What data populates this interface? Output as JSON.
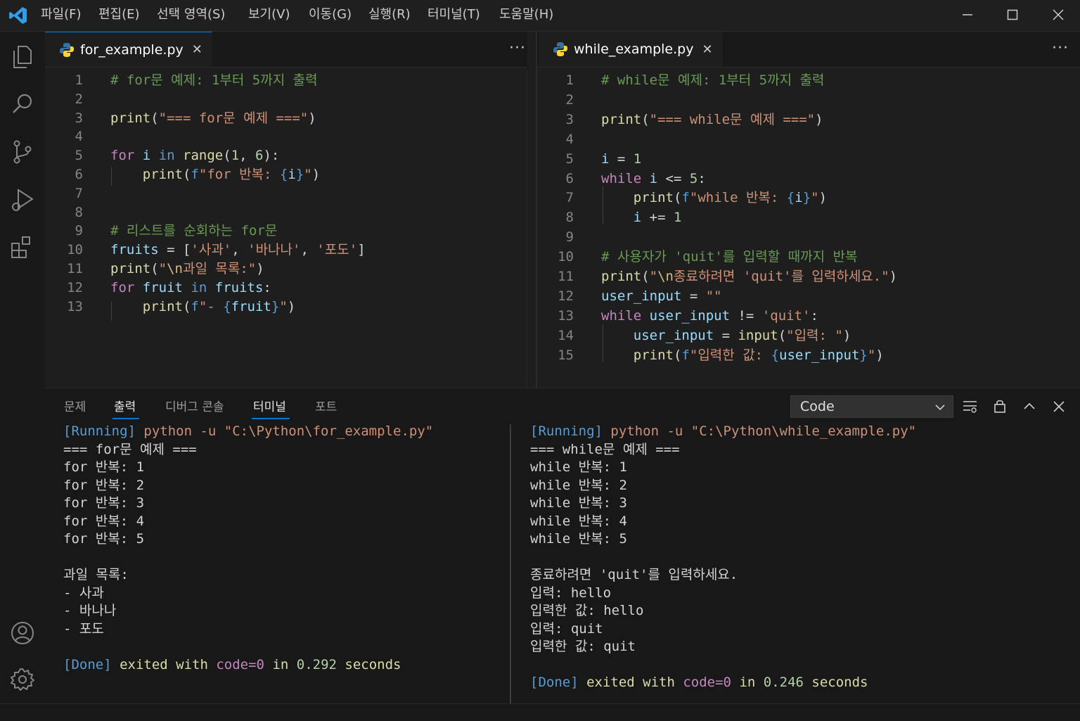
{
  "menu": [
    "파일(F)",
    "편집(E)",
    "선택 영역(S)",
    "보기(V)",
    "이동(G)",
    "실행(R)",
    "터미널(T)",
    "도움말(H)"
  ],
  "activity_icons": [
    "explorer-icon",
    "search-icon",
    "source-control-icon",
    "run-debug-icon",
    "extensions-icon",
    "account-icon",
    "settings-gear-icon"
  ],
  "editors": {
    "left": {
      "tab_label": "for_example.py",
      "lines": [
        [
          [
            "cm",
            "# for문 예제: 1부터 5까지 출력"
          ]
        ],
        [],
        [
          [
            "fn",
            "print"
          ],
          [
            "pl",
            "("
          ],
          [
            "str",
            "\"=== for문 예제 ===\""
          ],
          [
            "pl",
            ")"
          ]
        ],
        [],
        [
          [
            "kwc",
            "for"
          ],
          [
            "pl",
            " "
          ],
          [
            "var",
            "i"
          ],
          [
            "pl",
            " "
          ],
          [
            "kw",
            "in"
          ],
          [
            "pl",
            " "
          ],
          [
            "fn",
            "range"
          ],
          [
            "pl",
            "("
          ],
          [
            "num",
            "1"
          ],
          [
            "pl",
            ", "
          ],
          [
            "num",
            "6"
          ],
          [
            "pl",
            "):"
          ]
        ],
        [
          [
            "pl",
            "    "
          ],
          [
            "fn",
            "print"
          ],
          [
            "pl",
            "("
          ],
          [
            "kw",
            "f"
          ],
          [
            "str",
            "\"for 반복: "
          ],
          [
            "kw",
            "{"
          ],
          [
            "var",
            "i"
          ],
          [
            "kw",
            "}"
          ],
          [
            "str",
            "\""
          ],
          [
            "pl",
            ")"
          ]
        ],
        [],
        [],
        [
          [
            "cm",
            "# 리스트를 순회하는 for문"
          ]
        ],
        [
          [
            "var",
            "fruits"
          ],
          [
            "pl",
            " = ["
          ],
          [
            "str",
            "'사과'"
          ],
          [
            "pl",
            ", "
          ],
          [
            "str",
            "'바나나'"
          ],
          [
            "pl",
            ", "
          ],
          [
            "str",
            "'포도'"
          ],
          [
            "pl",
            "]"
          ]
        ],
        [
          [
            "fn",
            "print"
          ],
          [
            "pl",
            "("
          ],
          [
            "str",
            "\""
          ],
          [
            "esc",
            "\\n"
          ],
          [
            "str",
            "과일 목록:\""
          ],
          [
            "pl",
            ")"
          ]
        ],
        [
          [
            "kwc",
            "for"
          ],
          [
            "pl",
            " "
          ],
          [
            "var",
            "fruit"
          ],
          [
            "pl",
            " "
          ],
          [
            "kw",
            "in"
          ],
          [
            "pl",
            " "
          ],
          [
            "var",
            "fruits"
          ],
          [
            "pl",
            ":"
          ]
        ],
        [
          [
            "pl",
            "    "
          ],
          [
            "fn",
            "print"
          ],
          [
            "pl",
            "("
          ],
          [
            "kw",
            "f"
          ],
          [
            "str",
            "\"- "
          ],
          [
            "kw",
            "{"
          ],
          [
            "var",
            "fruit"
          ],
          [
            "kw",
            "}"
          ],
          [
            "str",
            "\""
          ],
          [
            "pl",
            ")"
          ]
        ]
      ]
    },
    "right": {
      "tab_label": "while_example.py",
      "lines": [
        [
          [
            "cm",
            "# while문 예제: 1부터 5까지 출력"
          ]
        ],
        [],
        [
          [
            "fn",
            "print"
          ],
          [
            "pl",
            "("
          ],
          [
            "str",
            "\"=== while문 예제 ===\""
          ],
          [
            "pl",
            ")"
          ]
        ],
        [],
        [
          [
            "var",
            "i"
          ],
          [
            "pl",
            " = "
          ],
          [
            "num",
            "1"
          ]
        ],
        [
          [
            "kwc",
            "while"
          ],
          [
            "pl",
            " "
          ],
          [
            "var",
            "i"
          ],
          [
            "pl",
            " <= "
          ],
          [
            "num",
            "5"
          ],
          [
            "pl",
            ":"
          ]
        ],
        [
          [
            "pl",
            "    "
          ],
          [
            "fn",
            "print"
          ],
          [
            "pl",
            "("
          ],
          [
            "kw",
            "f"
          ],
          [
            "str",
            "\"while 반복: "
          ],
          [
            "kw",
            "{"
          ],
          [
            "var",
            "i"
          ],
          [
            "kw",
            "}"
          ],
          [
            "str",
            "\""
          ],
          [
            "pl",
            ")"
          ]
        ],
        [
          [
            "pl",
            "    "
          ],
          [
            "var",
            "i"
          ],
          [
            "pl",
            " += "
          ],
          [
            "num",
            "1"
          ]
        ],
        [],
        [
          [
            "cm",
            "# 사용자가 'quit'를 입력할 때까지 반복"
          ]
        ],
        [
          [
            "fn",
            "print"
          ],
          [
            "pl",
            "("
          ],
          [
            "str",
            "\""
          ],
          [
            "esc",
            "\\n"
          ],
          [
            "str",
            "종료하려면 'quit'를 입력하세요.\""
          ],
          [
            "pl",
            ")"
          ]
        ],
        [
          [
            "var",
            "user_input"
          ],
          [
            "pl",
            " = "
          ],
          [
            "str",
            "\"\""
          ]
        ],
        [
          [
            "kwc",
            "while"
          ],
          [
            "pl",
            " "
          ],
          [
            "var",
            "user_input"
          ],
          [
            "pl",
            " != "
          ],
          [
            "str",
            "'quit'"
          ],
          [
            "pl",
            ":"
          ]
        ],
        [
          [
            "pl",
            "    "
          ],
          [
            "var",
            "user_input"
          ],
          [
            "pl",
            " = "
          ],
          [
            "fn",
            "input"
          ],
          [
            "pl",
            "("
          ],
          [
            "str",
            "\"입력: \""
          ],
          [
            "pl",
            ")"
          ]
        ],
        [
          [
            "pl",
            "    "
          ],
          [
            "fn",
            "print"
          ],
          [
            "pl",
            "("
          ],
          [
            "kw",
            "f"
          ],
          [
            "str",
            "\"입력한 값: "
          ],
          [
            "kw",
            "{"
          ],
          [
            "var",
            "user_input"
          ],
          [
            "kw",
            "}"
          ],
          [
            "str",
            "\""
          ],
          [
            "pl",
            ")"
          ]
        ]
      ]
    }
  },
  "panel": {
    "tabs": [
      "문제",
      "출력",
      "디버그 콘솔",
      "터미널",
      "포트"
    ],
    "active_tab": "출력",
    "output_channel": "Code",
    "left_output": {
      "running": "[Running]",
      "command": " python -u \"C:\\Python\\for_example.py\"",
      "lines": [
        "=== for문 예제 ===",
        "for 반복: 1",
        "for 반복: 2",
        "for 반복: 3",
        "for 반복: 4",
        "for 반복: 5",
        "",
        "과일 목록:",
        "- 사과",
        "- 바나나",
        "- 포도"
      ],
      "done": "[Done]",
      "exited_with": " exited with ",
      "code": "code=0",
      "in": " in ",
      "seconds_value": "0.292",
      "seconds": " seconds"
    },
    "right_output": {
      "running": "[Running]",
      "command": " python -u \"C:\\Python\\while_example.py\"",
      "lines": [
        "=== while문 예제 ===",
        "while 반복: 1",
        "while 반복: 2",
        "while 반복: 3",
        "while 반복: 4",
        "while 반복: 5",
        "",
        "종료하려면 'quit'를 입력하세요.",
        "입력: hello",
        "입력한 값: hello",
        "입력: quit",
        "입력한 값: quit"
      ],
      "done": "[Done]",
      "exited_with": " exited with ",
      "code": "code=0",
      "in": " in ",
      "seconds_value": "0.246",
      "seconds": " seconds"
    }
  },
  "colors": {
    "accent": "#0078d4",
    "keyword": "#569cd6",
    "control": "#c586c0",
    "function": "#dcdcaa",
    "string": "#ce9178",
    "number": "#b5cea8",
    "comment": "#6a9955",
    "variable": "#9cdcfe"
  }
}
